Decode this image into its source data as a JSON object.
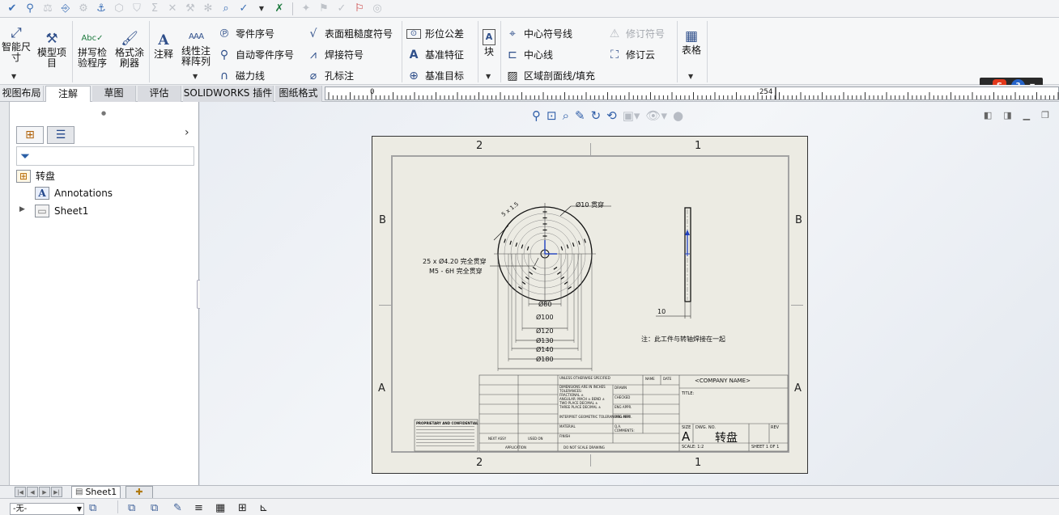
{
  "quick_toolbar": {
    "icons": [
      "check-smart-icon",
      "search-glass-icon",
      "balance-icon",
      "stamp-icon",
      "gear-dim-icon",
      "magnet-icon",
      "cube-dim-icon",
      "shield-dim-icon",
      "sigma-dim-icon",
      "x-dim-icon",
      "tools-dim-icon",
      "asterisk-dim-icon",
      "inspect-icon",
      "check-arrow-icon",
      "dropdown-arrow-icon",
      "excel-icon",
      "lock-dim-icon",
      "compare-dim-icon",
      "ok-dim-icon",
      "flag-icon",
      "globe-dim-icon"
    ]
  },
  "ribbon": {
    "smart_dimension": "智能尺\n寸",
    "model_items": "模型项\n目",
    "spell_checker": "拼写检\n验程序",
    "format_painter": "格式涂\n刷器",
    "note": "注释",
    "linear_note_pattern": "线性注\n释阵列",
    "balloon": "零件序号",
    "auto_balloon": "自动零件序号",
    "magnetic_line": "磁力线",
    "surface_finish": "表面粗糙度符号",
    "weld_symbol": "焊接符号",
    "hole_callout": "孔标注",
    "geometric_tolerance": "形位公差",
    "datum_feature": "基准特征",
    "datum_target": "基准目标",
    "blocks": "块",
    "center_mark": "中心符号线",
    "centerline": "中心线",
    "area_hatch": "区域剖面线/填充",
    "revision_symbol": "修订符号",
    "revision_cloud": "修订云",
    "tables": "表格"
  },
  "tabs": [
    {
      "label": "视图布局",
      "state": "normal"
    },
    {
      "label": "注解",
      "state": "active"
    },
    {
      "label": "草图",
      "state": "grey"
    },
    {
      "label": "评估",
      "state": "grey"
    },
    {
      "label": "SOLIDWORKS 插件",
      "state": "grey"
    },
    {
      "label": "图纸格式",
      "state": "grey"
    }
  ],
  "ruler": {
    "start": "0",
    "end": "254"
  },
  "tree": {
    "root": "转盘",
    "annotations": "Annotations",
    "sheet": "Sheet1"
  },
  "drawing": {
    "zones_top": [
      "2",
      "1"
    ],
    "zones_side": [
      "B",
      "A"
    ],
    "dims": {
      "chamfer": "5 x 1.5",
      "hole_dia": "Ø10 贯穿",
      "pattern_holes": "25 x Ø4.20 完全贯穿",
      "thread": "M5 - 6H 完全贯穿",
      "d80": "Ø80",
      "d100": "Ø100",
      "d120": "Ø120",
      "d130": "Ø130",
      "d140": "Ø140",
      "d180": "Ø180",
      "thickness": "10"
    },
    "note": "注：此工件与转轴焊接在一起",
    "title_block": {
      "company": "<COMPANY NAME>",
      "title_label": "TITLE:",
      "size_label": "SIZE",
      "size": "A",
      "dwg_label": "DWG. NO.",
      "dwg_no": "转盘",
      "rev_label": "REV",
      "scale": "SCALE: 1:2",
      "sheet": "SHEET 1 OF 1",
      "unless": "UNLESS OTHERWISE SPECIFIED",
      "dims_in": "DIMENSIONS ARE IN INCHES",
      "tolerances": "TOLERANCES:",
      "fractional": "FRACTIONAL ±",
      "angular": "ANGULAR: MACH ± BEND ±",
      "two_place": "TWO PLACE DECIMAL ±",
      "three_place": "THREE PLACE DECIMAL ±",
      "interpret": "INTERPRET GEOMETRIC TOLERANCING PER:",
      "material": "MATERIAL",
      "finish": "FINISH",
      "next_assy": "NEXT ASSY",
      "used_on": "USED ON",
      "application": "APPLICATION",
      "do_not_scale": "DO NOT SCALE DRAWING",
      "name": "NAME",
      "date": "DATE",
      "drawn": "DRAWN",
      "checked": "CHECKED",
      "eng_appr": "ENG APPR.",
      "mfg_appr": "MFG APPR.",
      "qa": "Q.A.",
      "comments": "COMMENTS:",
      "proprietary": "PROPRIETARY AND CONFIDENTIAL"
    }
  },
  "bottom": {
    "sheet_tab": "Sheet1",
    "config": "-无-"
  }
}
